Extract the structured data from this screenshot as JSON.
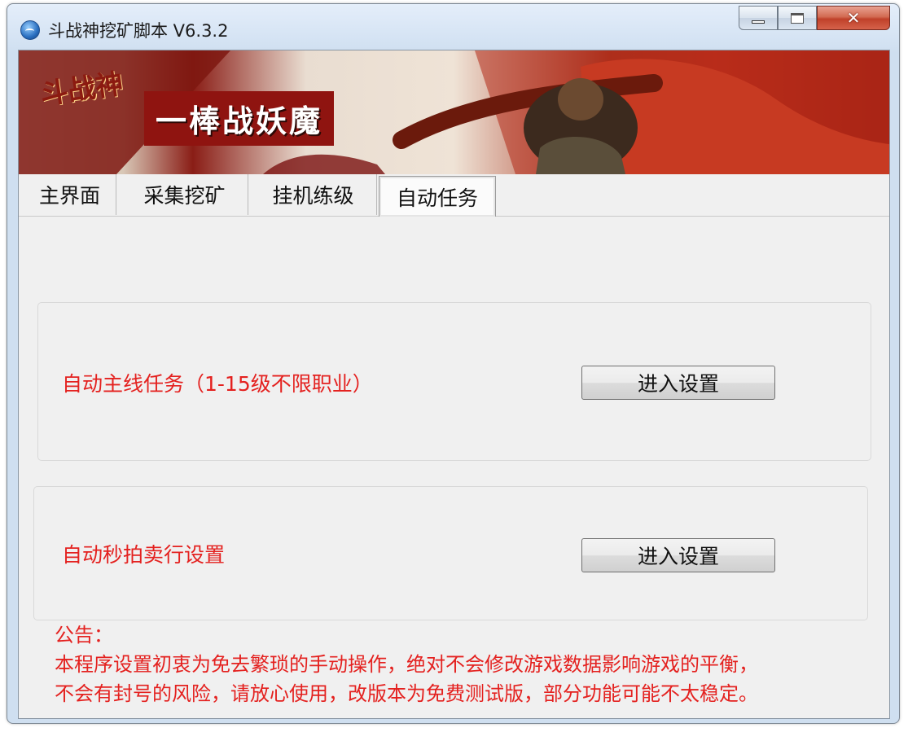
{
  "window": {
    "title": "斗战神挖矿脚本 V6.3.2"
  },
  "banner": {
    "tagline": "一棒战妖魔",
    "game_logo": "斗战神"
  },
  "tabs": [
    {
      "label": "主界面",
      "active": false
    },
    {
      "label": "采集挖矿",
      "active": false
    },
    {
      "label": "挂机练级",
      "active": false
    },
    {
      "label": "自动任务",
      "active": true
    }
  ],
  "tasks": [
    {
      "label": "自动主线任务（1-15级不限职业）",
      "button": "进入设置"
    },
    {
      "label": "自动秒拍卖行设置",
      "button": "进入设置"
    }
  ],
  "notice": {
    "heading": "公告：",
    "line1": "本程序设置初衷为免去繁琐的手动操作，绝对不会修改游戏数据影响游戏的平衡，",
    "line2": "不会有封号的风险，请放心使用，改版本为免费测试版，部分功能可能不太稳定。"
  },
  "colors": {
    "notice_text": "#e4211f",
    "banner_red": "#8f1410"
  }
}
